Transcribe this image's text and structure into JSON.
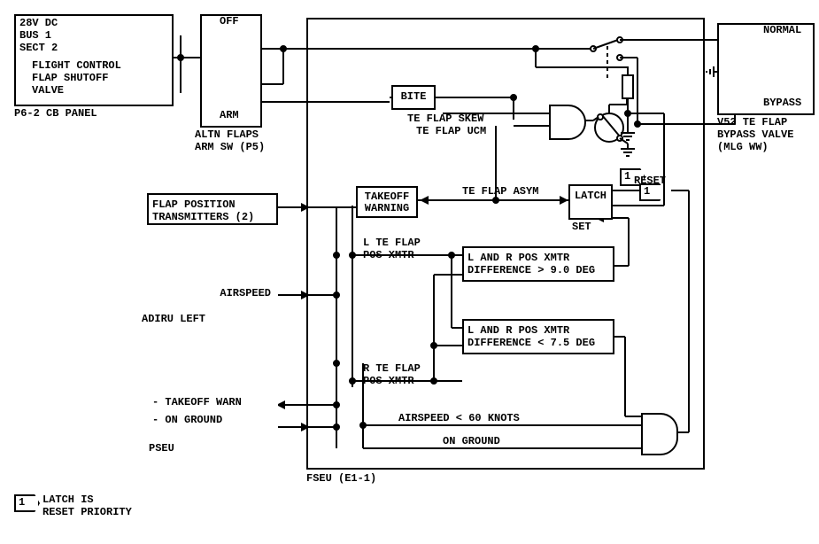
{
  "blocks": {
    "cb_panel": {
      "line1": "28V DC",
      "line2": "BUS 1",
      "line3": "SECT 2",
      "line4": "FLIGHT CONTROL",
      "line5": "FLAP SHUTOFF",
      "line6": "VALVE",
      "label": "P6-2 CB PANEL"
    },
    "altn_sw": {
      "off": "OFF",
      "arm": "ARM",
      "label": "ALTN FLAPS\nARM SW (P5)"
    },
    "bite": "BITE",
    "skew": "TE FLAP SKEW",
    "ucm": "TE FLAP UCM",
    "asym": "TE FLAP ASYM",
    "takeoff_warning": "TAKEOFF\nWARNING",
    "latch": "LATCH",
    "latch_set": "SET",
    "reset": "RESET",
    "reset_flag": "1",
    "flap_pos_xmtr": "FLAP POSITION\nTRANSMITTERS (2)",
    "l_pos_xmtr": "L TE FLAP\nPOS XMTR",
    "r_pos_xmtr": "R TE FLAP\nPOS XMTR",
    "diff_gt": "L AND R POS XMTR\nDIFFERENCE > 9.0 DEG",
    "diff_lt": "L AND R POS XMTR\nDIFFERENCE < 7.5 DEG",
    "airspeed": "AIRSPEED",
    "adiru": "ADIRU LEFT",
    "pseu": {
      "takeoff": "- TAKEOFF WARN",
      "ground": "- ON GROUND",
      "label": "PSEU"
    },
    "airspeed_lt": "AIRSPEED < 60 KNOTS",
    "on_ground": "ON GROUND",
    "fseu": "FSEU (E1-1)",
    "valve": {
      "normal": "NORMAL",
      "bypass": "BYPASS",
      "label": "V52 TE FLAP\nBYPASS VALVE\n(MLG WW)"
    },
    "footnote": {
      "flag": "1",
      "text": "LATCH IS\nRESET PRIORITY"
    }
  }
}
